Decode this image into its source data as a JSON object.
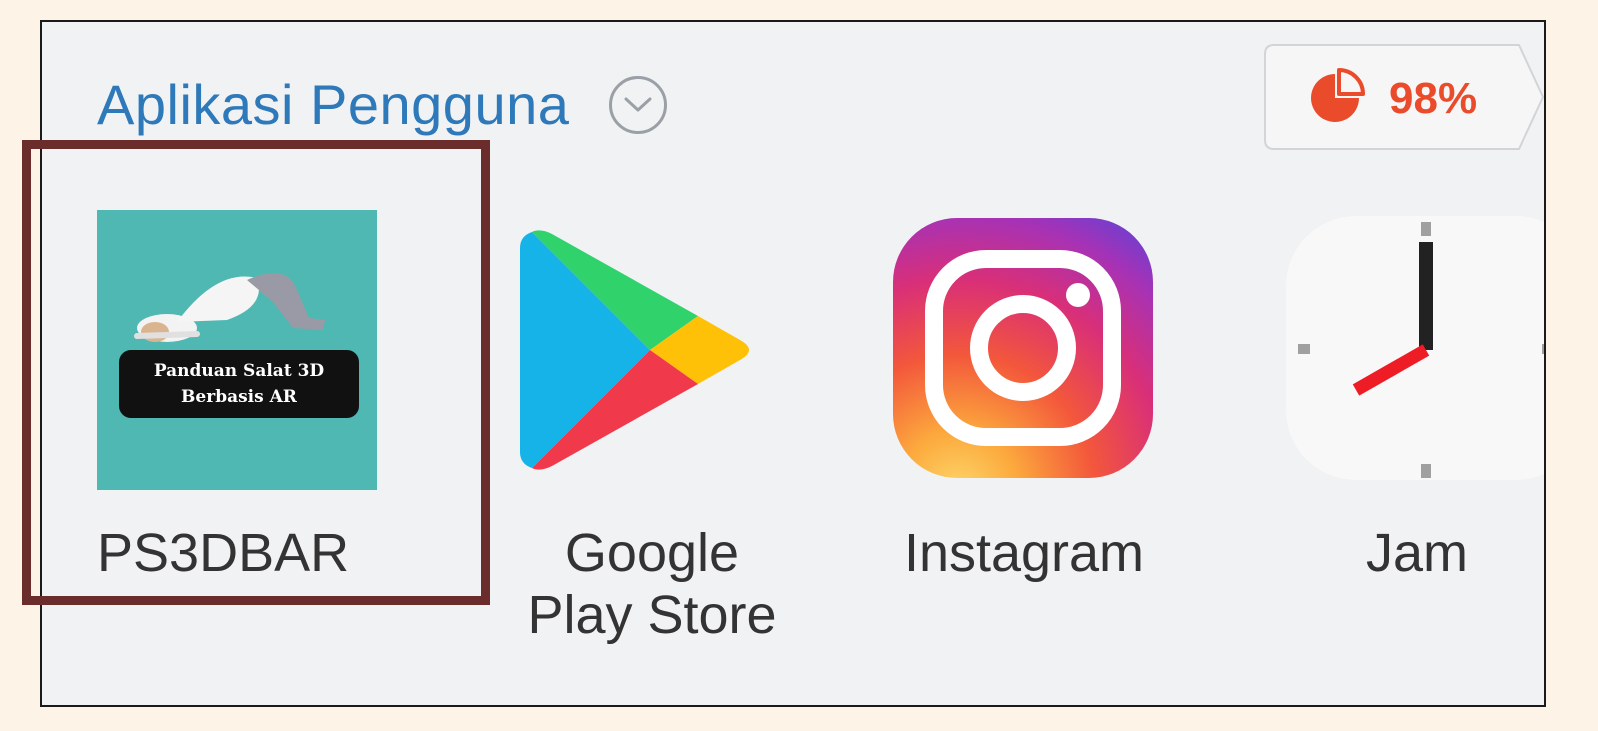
{
  "section": {
    "title": "Aplikasi Pengguna",
    "chevron_icon": "chevron-down-circle-icon"
  },
  "storage": {
    "icon": "pie-chart-icon",
    "percent": "98%",
    "color": "#ea4c2b"
  },
  "apps": [
    {
      "label": "PS3DBAR",
      "icon": "ps3dbar-app-icon",
      "icon_caption_line1": "Panduan Salat 3D",
      "icon_caption_line2": "Berbasis AR",
      "highlighted": true
    },
    {
      "label": "Google\nPlay Store",
      "icon": "google-play-store-icon"
    },
    {
      "label": "Instagram",
      "icon": "instagram-icon"
    },
    {
      "label": "Jam",
      "icon": "clock-icon"
    }
  ],
  "colors": {
    "accent_title": "#2e79b9",
    "highlight_border": "#6b2c2c",
    "ps3dbar_bg": "#4fb8b3"
  }
}
